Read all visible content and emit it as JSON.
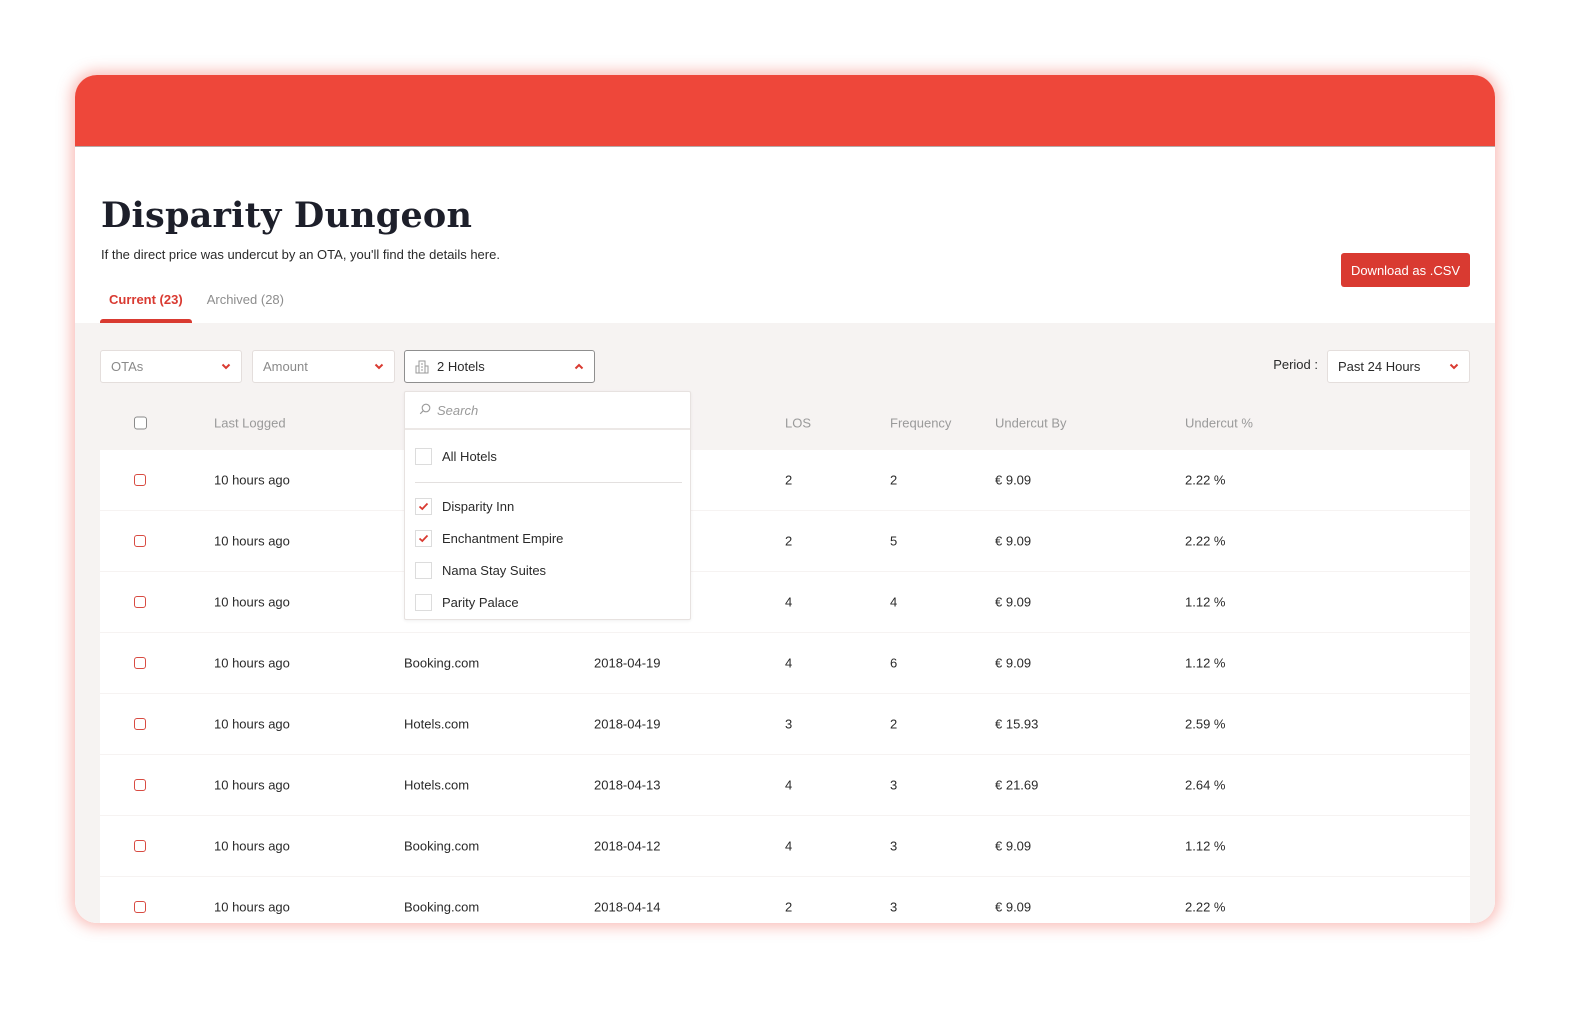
{
  "page": {
    "title": "Disparity Dungeon",
    "subtitle": "If the direct price was undercut by an OTA, you'll find the details here.",
    "download_label": "Download as .CSV"
  },
  "tabs": [
    {
      "label": "Current (23)",
      "active": true
    },
    {
      "label": "Archived (28)",
      "active": false
    }
  ],
  "filters": {
    "otas": {
      "placeholder": "OTAs",
      "icon": "chevron-down-icon"
    },
    "amount": {
      "placeholder": "Amount",
      "icon": "chevron-down-icon"
    },
    "hotels": {
      "value": "2 Hotels",
      "icon": "hotel-building-icon",
      "state": "open"
    },
    "period_label": "Period :",
    "period": {
      "value": "Past 24 Hours",
      "icon": "chevron-down-icon"
    }
  },
  "hotel_dropdown": {
    "search_placeholder": "Search",
    "all_label": "All Hotels",
    "all_checked": false,
    "items": [
      {
        "label": "Disparity Inn",
        "checked": true
      },
      {
        "label": "Enchantment Empire",
        "checked": true
      },
      {
        "label": "Nama Stay Suites",
        "checked": false
      },
      {
        "label": "Parity Palace",
        "checked": false
      }
    ]
  },
  "table": {
    "columns": [
      "Last Logged",
      "",
      "",
      "LOS",
      "Frequency",
      "Undercut By",
      "Undercut %"
    ],
    "rows": [
      {
        "last_logged": "10 hours ago",
        "ota": "",
        "date": "",
        "los": "2",
        "frequency": "2",
        "undercut_by": "€ 9.09",
        "undercut_pct": "2.22 %"
      },
      {
        "last_logged": "10 hours ago",
        "ota": "",
        "date": "",
        "los": "2",
        "frequency": "5",
        "undercut_by": "€ 9.09",
        "undercut_pct": "2.22 %"
      },
      {
        "last_logged": "10 hours ago",
        "ota": "",
        "date": "",
        "los": "4",
        "frequency": "4",
        "undercut_by": "€ 9.09",
        "undercut_pct": "1.12 %"
      },
      {
        "last_logged": "10 hours ago",
        "ota": "Booking.com",
        "date": "2018-04-19",
        "los": "4",
        "frequency": "6",
        "undercut_by": "€ 9.09",
        "undercut_pct": "1.12 %"
      },
      {
        "last_logged": "10 hours ago",
        "ota": "Hotels.com",
        "date": "2018-04-19",
        "los": "3",
        "frequency": "2",
        "undercut_by": "€ 15.93",
        "undercut_pct": "2.59 %"
      },
      {
        "last_logged": "10 hours ago",
        "ota": "Hotels.com",
        "date": "2018-04-13",
        "los": "4",
        "frequency": "3",
        "undercut_by": "€ 21.69",
        "undercut_pct": "2.64 %"
      },
      {
        "last_logged": "10 hours ago",
        "ota": "Booking.com",
        "date": "2018-04-12",
        "los": "4",
        "frequency": "3",
        "undercut_by": "€ 9.09",
        "undercut_pct": "1.12 %"
      },
      {
        "last_logged": "10 hours ago",
        "ota": "Booking.com",
        "date": "2018-04-14",
        "los": "2",
        "frequency": "3",
        "undercut_by": "€ 9.09",
        "undercut_pct": "2.22 %"
      }
    ]
  },
  "colors": {
    "brand": "#ee473a",
    "accent": "#d93a31",
    "panel_bg": "#f6f3f2"
  }
}
